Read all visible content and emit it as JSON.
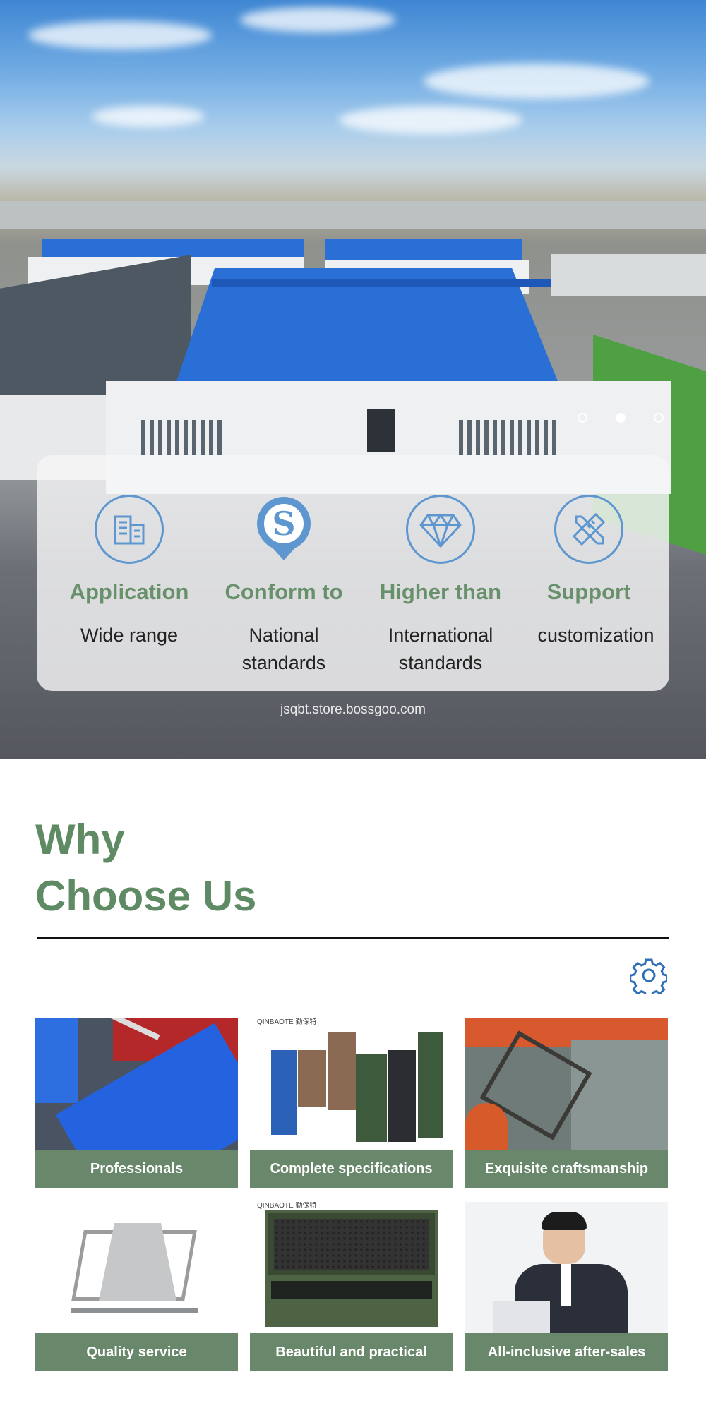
{
  "hero": {
    "carousel": {
      "dot_count": 3,
      "active_index": 1
    },
    "features": [
      {
        "title": "Application",
        "desc": "Wide range",
        "icon": "building-icon"
      },
      {
        "title": "Conform to",
        "desc": "National standards",
        "icon": "standard-s-icon"
      },
      {
        "title": "Higher than",
        "desc": "International standards",
        "icon": "diamond-icon"
      },
      {
        "title": "Support",
        "desc": "customization",
        "icon": "ruler-pencil-icon"
      }
    ],
    "watermark": "jsqbt.store.bossgoo.com"
  },
  "why": {
    "title_line1": "Why",
    "title_line2": "Choose Us",
    "settings_icon": "gear-icon",
    "cards": [
      {
        "caption": "Professionals"
      },
      {
        "caption": "Complete specifications",
        "brand": "QINBAOTE 勤保特"
      },
      {
        "caption": "Exquisite craftsmanship"
      },
      {
        "caption": "Quality service"
      },
      {
        "caption": "Beautiful and practical",
        "brand": "QINBAOTE 勤保特"
      },
      {
        "caption": "All-inclusive after-sales"
      }
    ]
  },
  "colors": {
    "accent_green": "#68876b",
    "title_green": "#5e8a64",
    "icon_blue": "#5e97cf",
    "roof_blue": "#2a6fd6"
  }
}
